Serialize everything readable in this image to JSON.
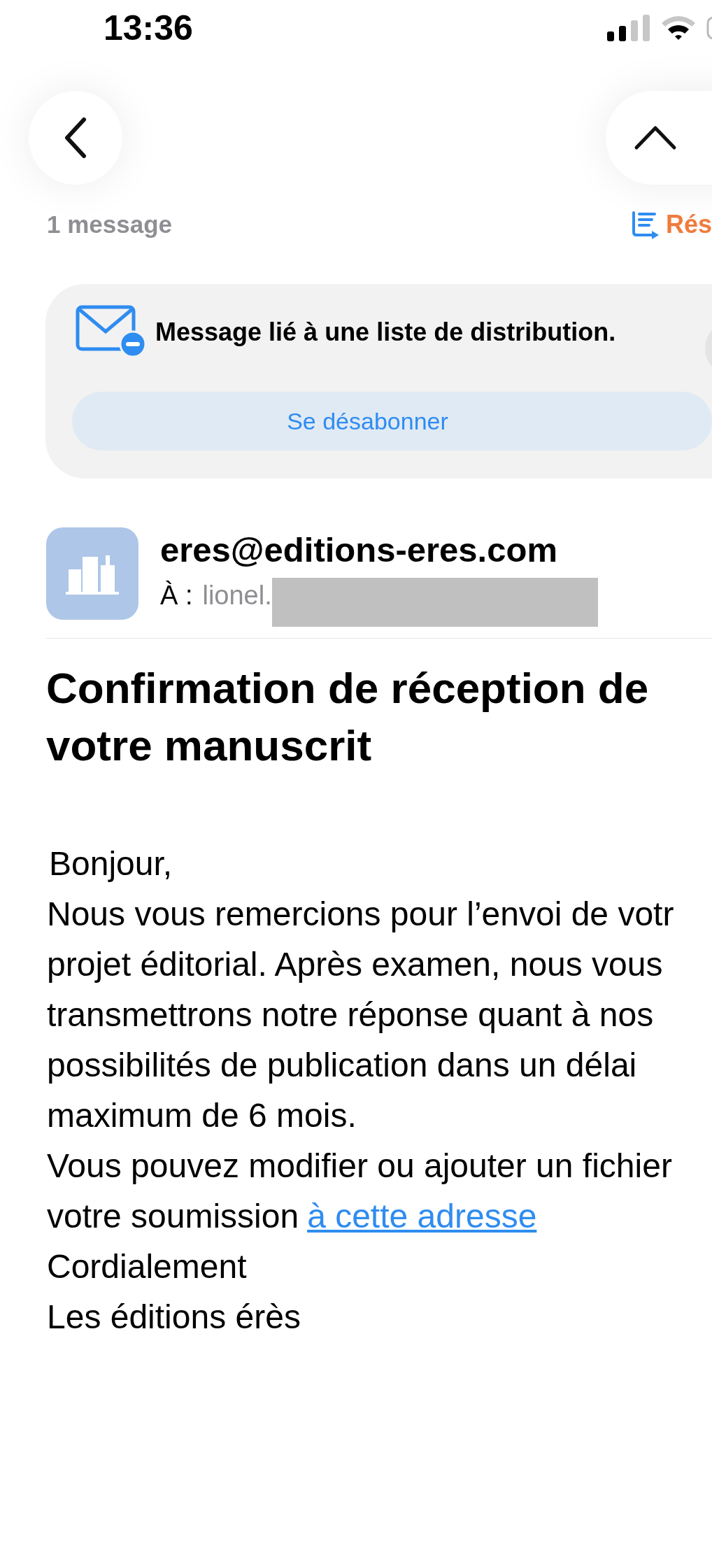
{
  "status_bar": {
    "time": "13:36"
  },
  "header": {
    "message_count": "1 message",
    "summary_label": "Rés"
  },
  "list_banner": {
    "text": "Message lié à une liste de distribution.",
    "button": "Se désabonner"
  },
  "sender": {
    "address": "eres@editions-eres.com",
    "to_label": "À :",
    "to_value": "lionel."
  },
  "subject": "Confirmation de réception de votre manuscrit",
  "body": [
    {
      "kind": "text",
      "text": "Bonjour,"
    },
    {
      "kind": "text",
      "text": "Nous vous remercions pour l’envoi de votr"
    },
    {
      "kind": "text",
      "text": "projet éditorial. Après examen, nous vous"
    },
    {
      "kind": "text",
      "text": "transmettrons notre réponse quant à nos"
    },
    {
      "kind": "text",
      "text": "possibilités de publication dans un délai"
    },
    {
      "kind": "text",
      "text": "maximum de 6 mois."
    },
    {
      "kind": "text",
      "text": "Vous pouvez modifier ou ajouter un fichier"
    },
    {
      "kind": "link",
      "text": "votre soumission",
      "link": "à cette adresse"
    },
    {
      "kind": "text",
      "text": "Cordialement"
    },
    {
      "kind": "text",
      "text": "Les éditions érès"
    }
  ]
}
